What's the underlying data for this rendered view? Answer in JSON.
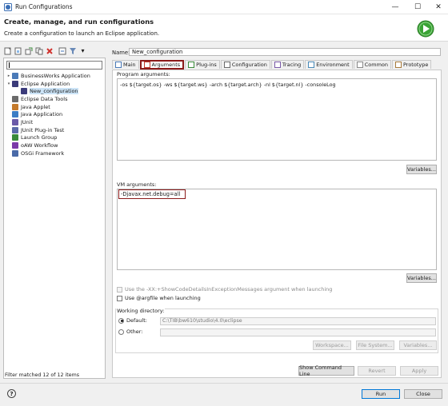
{
  "window": {
    "title": "Run Configurations",
    "minimize_icon": "minimize-icon",
    "maximize_icon": "maximize-icon",
    "close_icon": "close-icon"
  },
  "header": {
    "title": "Create, manage, and run configurations",
    "subtitle": "Create a configuration to launch an Eclipse application.",
    "run_icon_color": "#3aa335"
  },
  "left": {
    "toolbar_icons": [
      "new-config-icon",
      "new-prototype-icon",
      "export-icon",
      "duplicate-icon",
      "delete-icon",
      "collapse-all-icon",
      "filter-icon",
      "view-menu-icon"
    ],
    "filter_value": "",
    "tree": [
      {
        "label": "BusinessWorks Application",
        "level": 0,
        "twisty": "›",
        "icon": "bw-icon",
        "color": "#4a7ab8"
      },
      {
        "label": "Eclipse Application",
        "level": 0,
        "twisty": "⌄",
        "icon": "eclipse-icon",
        "color": "#3b3b7a"
      },
      {
        "label": "New_configuration",
        "level": 1,
        "twisty": "",
        "icon": "eclipse-icon",
        "color": "#3b3b7a",
        "selected": true
      },
      {
        "label": "Eclipse Data Tools",
        "level": 0,
        "twisty": "",
        "icon": "data-tools-icon",
        "color": "#6b6b6b"
      },
      {
        "label": "Java Applet",
        "level": 0,
        "twisty": "",
        "icon": "applet-icon",
        "color": "#c47a2c"
      },
      {
        "label": "Java Application",
        "level": 0,
        "twisty": "",
        "icon": "java-app-icon",
        "color": "#3c7dc4"
      },
      {
        "label": "JUnit",
        "level": 0,
        "twisty": "",
        "icon": "junit-icon",
        "color": "#6a5aa8"
      },
      {
        "label": "JUnit Plug-in Test",
        "level": 0,
        "twisty": "",
        "icon": "junit-plugin-icon",
        "color": "#5a6aa8"
      },
      {
        "label": "Launch Group",
        "level": 0,
        "twisty": "",
        "icon": "launch-group-icon",
        "color": "#3a8a3a"
      },
      {
        "label": "oAW Workflow",
        "level": 0,
        "twisty": "",
        "icon": "workflow-icon",
        "color": "#7a3aa8"
      },
      {
        "label": "OSGi Framework",
        "level": 0,
        "twisty": "",
        "icon": "osgi-icon",
        "color": "#4a6aa8"
      }
    ],
    "filter_status": "Filter matched 12 of 12 items"
  },
  "right": {
    "name_label": "Name:",
    "name_value": "New_configuration",
    "tabs": [
      {
        "label": "Main",
        "icon": "main-icon",
        "active": false
      },
      {
        "label": "Arguments",
        "icon": "arguments-icon",
        "active": true
      },
      {
        "label": "Plug-ins",
        "icon": "plugins-icon",
        "active": false
      },
      {
        "label": "Configuration",
        "icon": "configuration-icon",
        "active": false
      },
      {
        "label": "Tracing",
        "icon": "tracing-icon",
        "active": false
      },
      {
        "label": "Environment",
        "icon": "environment-icon",
        "active": false
      },
      {
        "label": "Common",
        "icon": "common-icon",
        "active": false
      },
      {
        "label": "Prototype",
        "icon": "prototype-icon",
        "active": false
      }
    ],
    "program_args_label": "Program arguments:",
    "program_args_value": "-os ${target.os} -ws ${target.ws} -arch ${target.arch} -nl ${target.nl} -consoleLog",
    "variables_label": "Variables...",
    "vm_args_label": "VM arguments:",
    "vm_args_value": "-Djavax.net.debug=all",
    "show_code_details_label": "Use the -XX:+ShowCodeDetailsInExceptionMessages argument when launching",
    "argfile_label": "Use @argfile when launching",
    "working_dir_label": "Working directory:",
    "default_label": "Default:",
    "default_value": "C:\\TIB\\bw610\\studio\\4.0\\eclipse",
    "other_label": "Other:",
    "workspace_label": "Workspace...",
    "filesystem_label": "File System...",
    "wd_variables_label": "Variables..."
  },
  "bottom": {
    "show_command_line_label": "Show Command Line",
    "revert_label": "Revert",
    "apply_label": "Apply",
    "run_label": "Run",
    "close_label": "Close",
    "help_icon": "help-icon"
  },
  "colors": {
    "highlight_border": "#8b1a1a",
    "selection_bg": "#cce4f7",
    "run_button_border": "#0078d7"
  }
}
